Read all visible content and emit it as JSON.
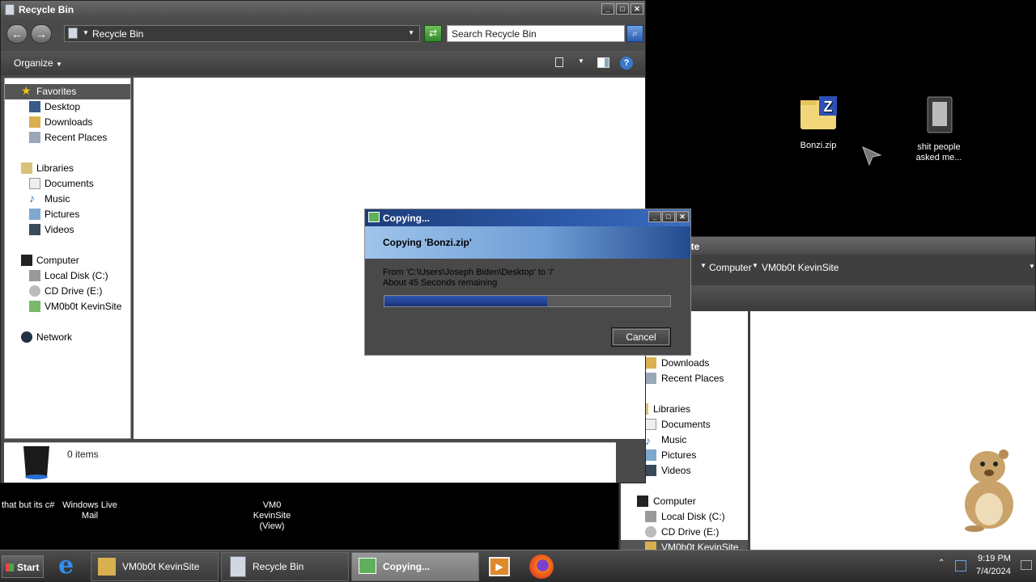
{
  "desktop": {
    "icons": [
      {
        "label": "Bonzi.zip"
      },
      {
        "label": "shit people asked me..."
      }
    ],
    "bottom_labels": [
      "that but its c#",
      "Windows Live Mail",
      "VM0 KevinSite (View)"
    ]
  },
  "recycle_window": {
    "title": "Recycle Bin",
    "address": "Recycle Bin",
    "search_placeholder": "Search Recycle Bin",
    "organize": "Organize",
    "nav": {
      "favorites": "Favorites",
      "desktop": "Desktop",
      "downloads": "Downloads",
      "recent": "Recent Places",
      "libraries": "Libraries",
      "documents": "Documents",
      "music": "Music",
      "pictures": "Pictures",
      "videos": "Videos",
      "computer": "Computer",
      "local_disk": "Local Disk (C:)",
      "cd_drive": "CD Drive (E:)",
      "share": "VM0b0t KevinSite",
      "network": "Network"
    },
    "item_count": "0 items"
  },
  "back_window": {
    "title_partial": "nSite",
    "breadcrumb": [
      "Computer",
      "VM0b0t KevinSite"
    ],
    "nav": {
      "downloads": "Downloads",
      "recent": "Recent Places",
      "libraries": "Libraries",
      "documents": "Documents",
      "music": "Music",
      "pictures": "Pictures",
      "videos": "Videos",
      "computer": "Computer",
      "local_disk": "Local Disk (C:)",
      "cd_drive": "CD Drive (E:)",
      "share": "VM0b0t KevinSite"
    }
  },
  "copy_dialog": {
    "title": "Copying...",
    "heading": "Copying 'Bonzi.zip'",
    "from_text": "From 'C:\\Users\\Joseph Biden\\Desktop' to '/'",
    "remaining": "About 45 Seconds remaining",
    "progress": 0.57,
    "cancel": "Cancel"
  },
  "taskbar": {
    "start": "Start",
    "buttons": [
      {
        "label": "VM0b0t KevinSite"
      },
      {
        "label": "Recycle Bin"
      },
      {
        "label": "Copying..."
      }
    ],
    "time": "9:19 PM",
    "date": "7/4/2024"
  },
  "colors": {
    "dialog_title": "#2c58a8",
    "progress": "#1e3a8a",
    "desktop": "#000000"
  }
}
